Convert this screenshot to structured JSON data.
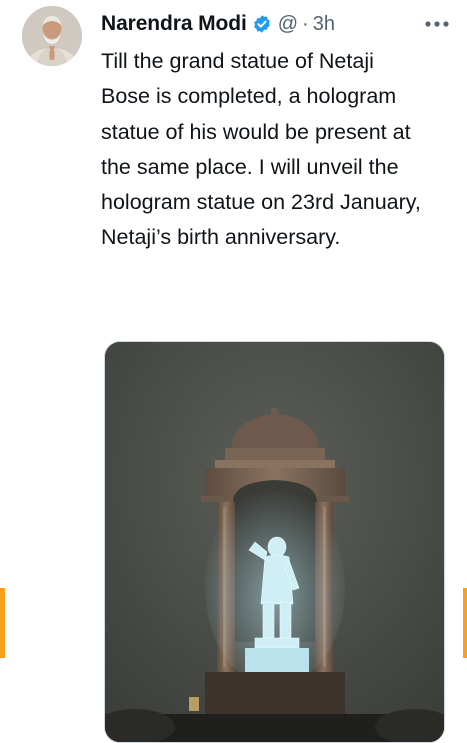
{
  "tweet": {
    "author": {
      "name": "Narendra Modi",
      "handle": "@",
      "verified": true
    },
    "separator": "·",
    "time": "3h",
    "text": "Till the grand statue of Netaji Bose is completed, a hologram statue of his would be present at the same place. I will unveil the hologram statue on 23rd January, Netaji’s birth anniversary.",
    "media": {
      "type": "photo",
      "subject": "hologram-statue-under-canopy-at-night"
    }
  },
  "colors": {
    "text_primary": "#0f1419",
    "text_secondary": "#536471",
    "verified_blue": "#1d9bf0",
    "edge_accent": "#f7a01c"
  },
  "icons": {
    "verified": "verified-badge-icon",
    "more": "more-horizontal-icon"
  }
}
